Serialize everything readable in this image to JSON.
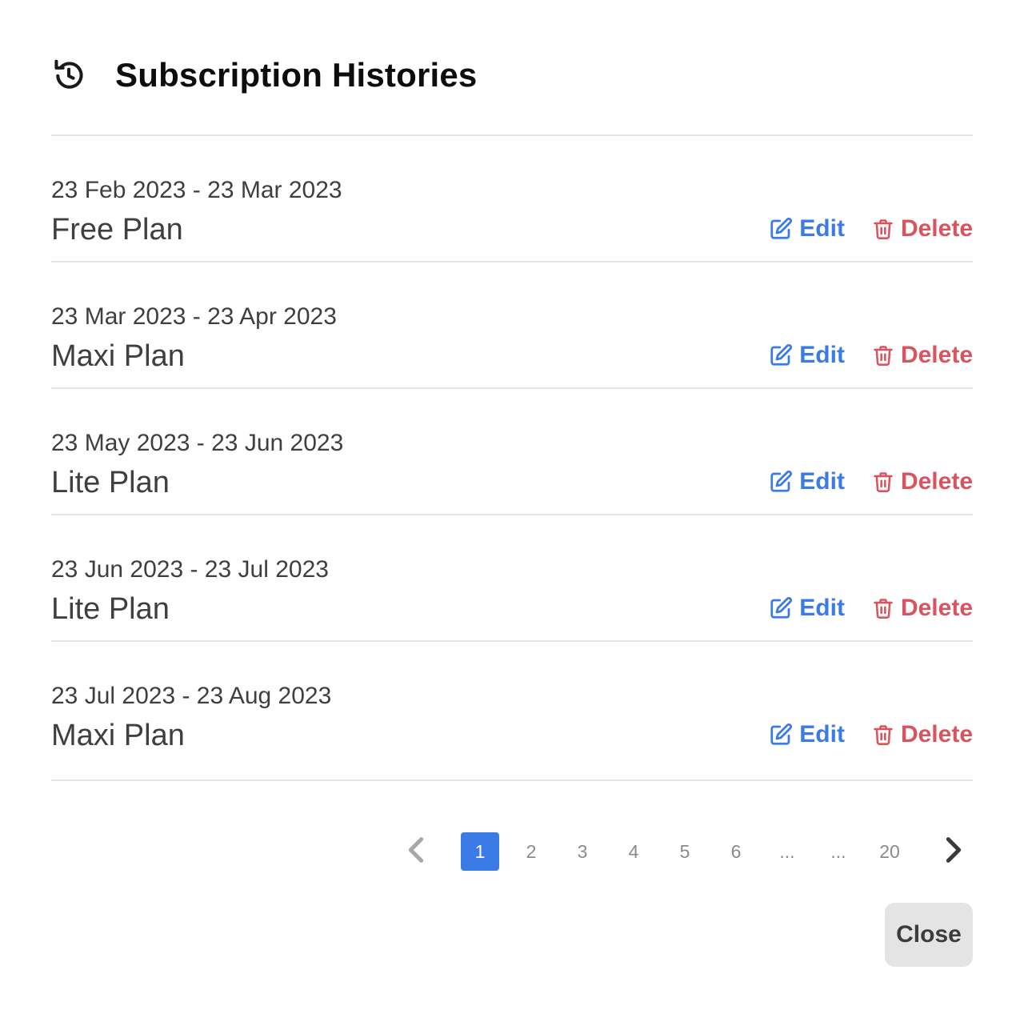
{
  "header": {
    "title": "Subscription Histories",
    "icon": "history-icon"
  },
  "items": [
    {
      "date_range": "23 Feb 2023 - 23 Mar 2023",
      "plan": "Free Plan",
      "edit_label": "Edit",
      "delete_label": "Delete"
    },
    {
      "date_range": "23 Mar 2023 - 23 Apr 2023",
      "plan": "Maxi Plan",
      "edit_label": "Edit",
      "delete_label": "Delete"
    },
    {
      "date_range": "23 May 2023 - 23 Jun 2023",
      "plan": "Lite Plan",
      "edit_label": "Edit",
      "delete_label": "Delete"
    },
    {
      "date_range": "23 Jun 2023 - 23 Jul 2023",
      "plan": "Lite Plan",
      "edit_label": "Edit",
      "delete_label": "Delete"
    },
    {
      "date_range": "23 Jul 2023 - 23 Aug 2023",
      "plan": "Maxi Plan",
      "edit_label": "Edit",
      "delete_label": "Delete"
    }
  ],
  "pagination": {
    "pages": [
      "1",
      "2",
      "3",
      "4",
      "5",
      "6",
      "...",
      "...",
      "20"
    ],
    "current": "1"
  },
  "footer": {
    "close_label": "Close"
  },
  "colors": {
    "accent": "#3b7be8",
    "danger": "#d9545f",
    "divider": "#e6e6e6",
    "close_bg": "#e4e4e4"
  }
}
